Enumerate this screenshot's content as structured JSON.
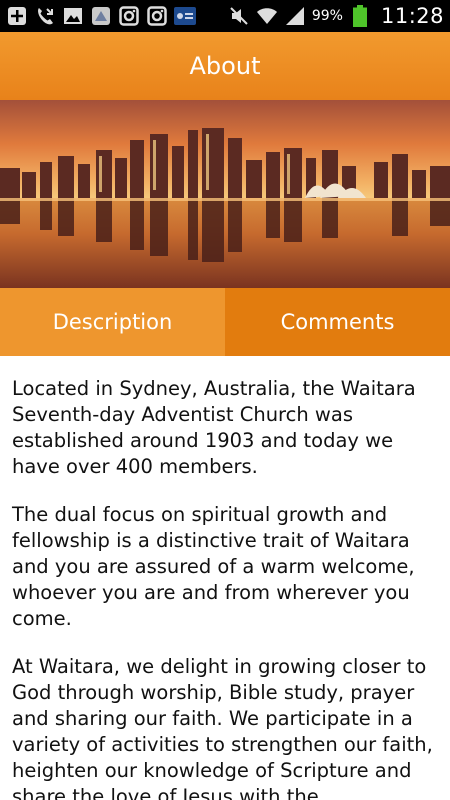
{
  "status_bar": {
    "battery_percent": "99%",
    "time": "11:28",
    "left_icons": [
      "add-box-icon",
      "missed-call-icon",
      "image-icon",
      "app-icon",
      "instagram-icon",
      "instagram-icon",
      "news-app-icon"
    ],
    "right_icons": [
      "mute-icon",
      "wifi-icon",
      "signal-icon",
      "battery-icon"
    ]
  },
  "action_bar": {
    "title": "About",
    "color": "#ee8e25"
  },
  "tabs": [
    {
      "label": "Description",
      "selected": true
    },
    {
      "label": "Comments",
      "selected": false
    }
  ],
  "content": {
    "paragraphs": [
      "Located in Sydney, Australia, the Waitara Seventh-day Adventist Church was established around 1903 and today we have over 400 members.",
      "The dual focus on spiritual growth and fellowship is a distinctive trait of Waitara and you are assured of a warm welcome, whoever you are and from wherever you come.",
      "At Waitara, we delight in growing closer to God through worship, Bible study, prayer and sharing our faith. We participate in a variety of activities to strengthen our faith, heighten our knowledge of Scripture and share the love of Jesus with the"
    ]
  },
  "colors": {
    "accent": "#ee962e",
    "accent_dark": "#e27c0e",
    "text": "#111111"
  }
}
